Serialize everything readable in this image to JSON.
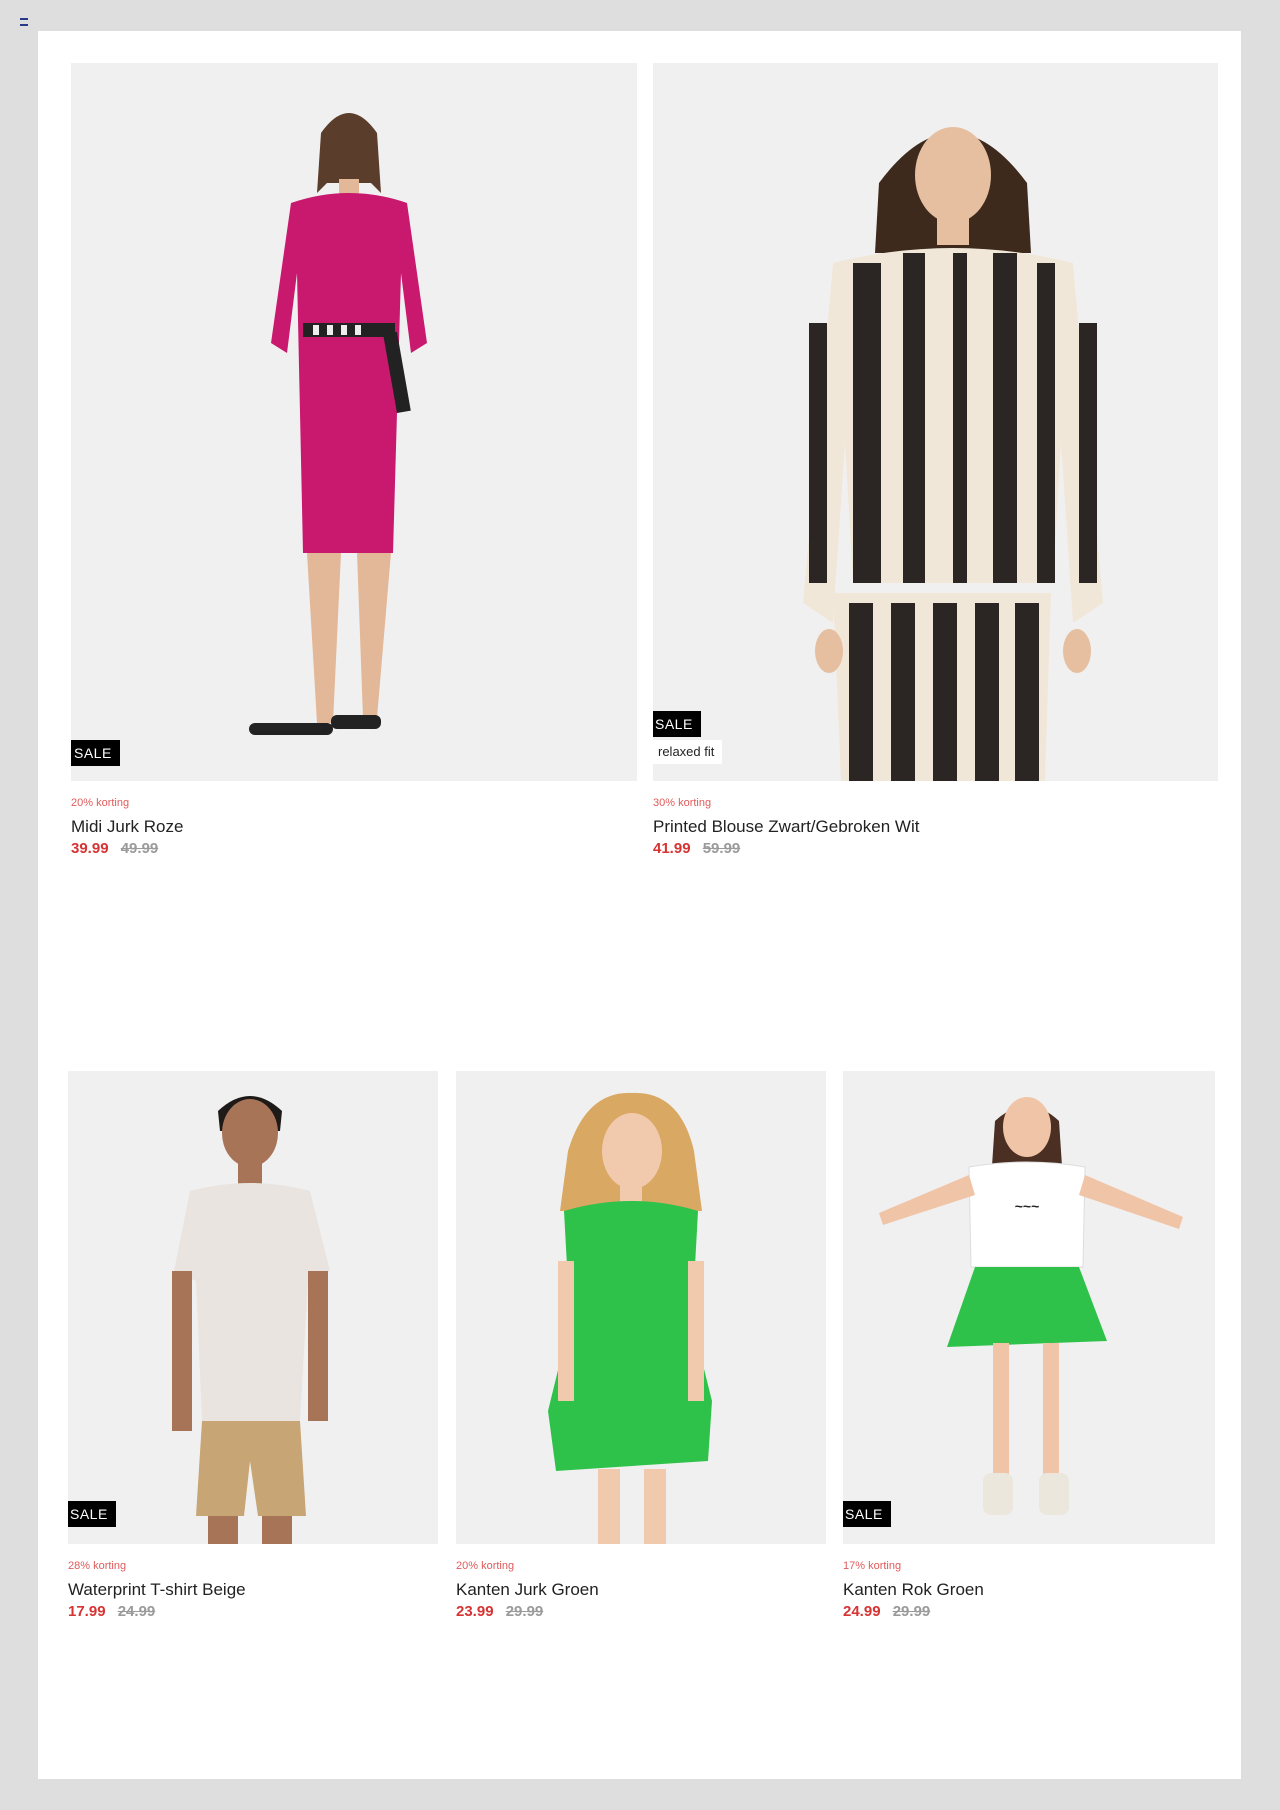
{
  "products": [
    {
      "discount": "20% korting",
      "name": "Midi Jurk Roze",
      "price_new": "39.99",
      "price_old": "49.99",
      "sale_badge": "SALE",
      "garment_color": "#c8196f"
    },
    {
      "discount": "30% korting",
      "name": "Printed Blouse Zwart/Gebroken Wit",
      "price_new": "41.99",
      "price_old": "59.99",
      "sale_badge": "SALE",
      "fit_badge": "relaxed fit",
      "garment_color": "#2b2623"
    },
    {
      "discount": "28% korting",
      "name": "Waterprint T-shirt Beige",
      "price_new": "17.99",
      "price_old": "24.99",
      "sale_badge": "SALE",
      "garment_color": "#e9e4df"
    },
    {
      "discount": "20% korting",
      "name": "Kanten Jurk Groen",
      "price_new": "23.99",
      "price_old": "29.99",
      "garment_color": "#2fc24a"
    },
    {
      "discount": "17% korting",
      "name": "Kanten Rok Groen",
      "price_new": "24.99",
      "price_old": "29.99",
      "sale_badge": "SALE",
      "garment_color": "#2fc24a"
    }
  ]
}
